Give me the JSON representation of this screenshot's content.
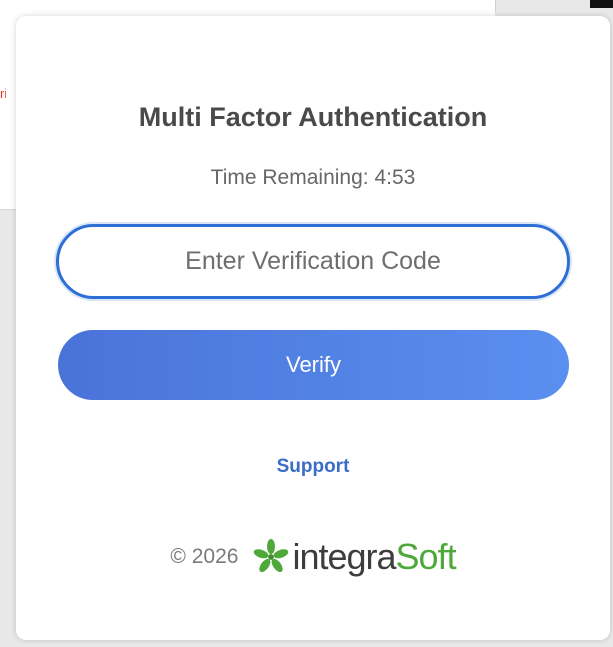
{
  "background": {
    "sliver_text": "ri"
  },
  "mfa": {
    "title": "Multi Factor Authentication",
    "timer_text": "Time Remaining: 4:53",
    "code_placeholder": "Enter Verification Code",
    "code_value": "",
    "verify_label": "Verify",
    "support_label": "Support"
  },
  "footer": {
    "copyright": "© 2026",
    "logo_part1": "integra",
    "logo_part2": "Soft",
    "logo_icon": "leaf-flower-icon"
  },
  "colors": {
    "accent": "#2e6fd6",
    "button_start": "#4a73d8",
    "button_end": "#5a8ff0",
    "logo_green": "#4fa93a",
    "support_link": "#3b6cc6"
  }
}
